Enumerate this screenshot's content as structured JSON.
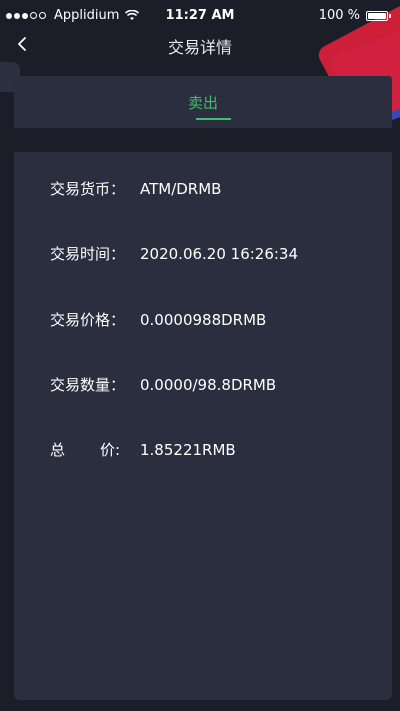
{
  "status_bar": {
    "carrier": "Applidium",
    "time": "11:27 AM",
    "battery": "100 %",
    "battery_level": 1.0
  },
  "nav": {
    "title": "交易详情"
  },
  "tab": {
    "label": "卖出"
  },
  "details": {
    "currency_label": "交易货币：",
    "currency_value": "ATM/DRMB",
    "time_label": "交易时间：",
    "time_value": "2020.06.20 16:26:34",
    "price_label": "交易价格：",
    "price_value": "0.0000988DRMB",
    "quantity_label": "交易数量：",
    "quantity_value": "0.0000/98.8DRMB",
    "total_label_first": "总",
    "total_label_second": "价:",
    "total_value": "1.85221RMB"
  },
  "colors": {
    "background": "#1b1e29",
    "card": "#2a2e3e",
    "accent_green": "#3fbf6a"
  }
}
